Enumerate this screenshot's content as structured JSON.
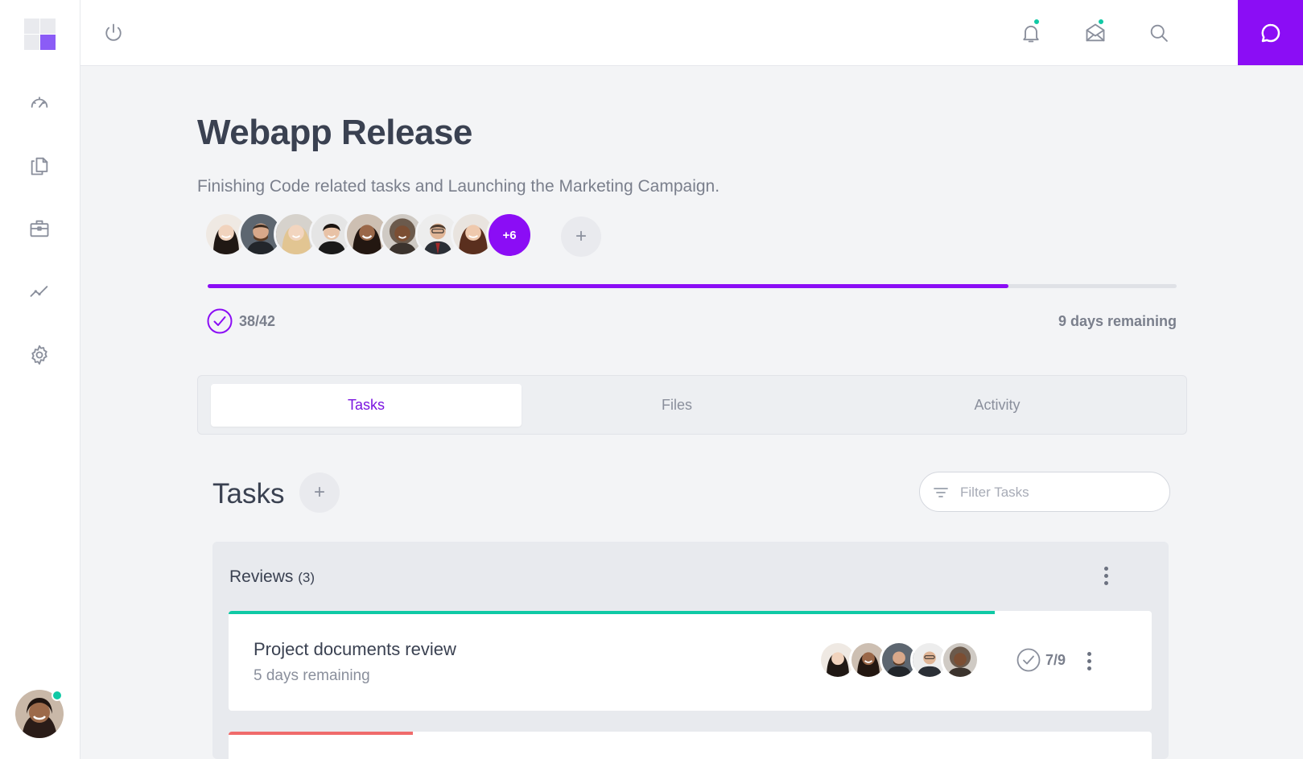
{
  "project": {
    "title": "Webapp Release",
    "description": "Finishing Code related tasks and Launching the Marketing Campaign.",
    "extra_members": "+6",
    "add_member_label": "+",
    "progress_fraction": 0.826,
    "tasks_done": "38/42",
    "days_remaining": "9 days remaining"
  },
  "icons": {
    "logo": "logo-icon",
    "sidebar": [
      "dashboard-icon",
      "documents-icon",
      "briefcase-icon",
      "analytics-icon",
      "settings-icon"
    ],
    "topbar": [
      "power-icon",
      "notification-bell-icon",
      "mail-icon",
      "search-icon",
      "chat-icon"
    ]
  },
  "tabs": [
    "Tasks",
    "Files",
    "Activity"
  ],
  "tasks_section": {
    "heading": "Tasks",
    "add_label": "+",
    "filter_placeholder": "Filter Tasks"
  },
  "group": {
    "title": "Reviews",
    "count": "(3)",
    "tasks": [
      {
        "name": "Project documents review",
        "remaining": "5 days remaining",
        "count": "7/9",
        "progress_fraction": 0.83,
        "bar_color": "#10c9a5"
      },
      {
        "progress_fraction": 0.2,
        "bar_color": "#f06b6b"
      }
    ]
  },
  "colors": {
    "accent": "#8b0df5",
    "online_dot": "#10c9a5",
    "task_bar_green": "#10c9a5",
    "task_bar_red": "#f06b6b"
  }
}
